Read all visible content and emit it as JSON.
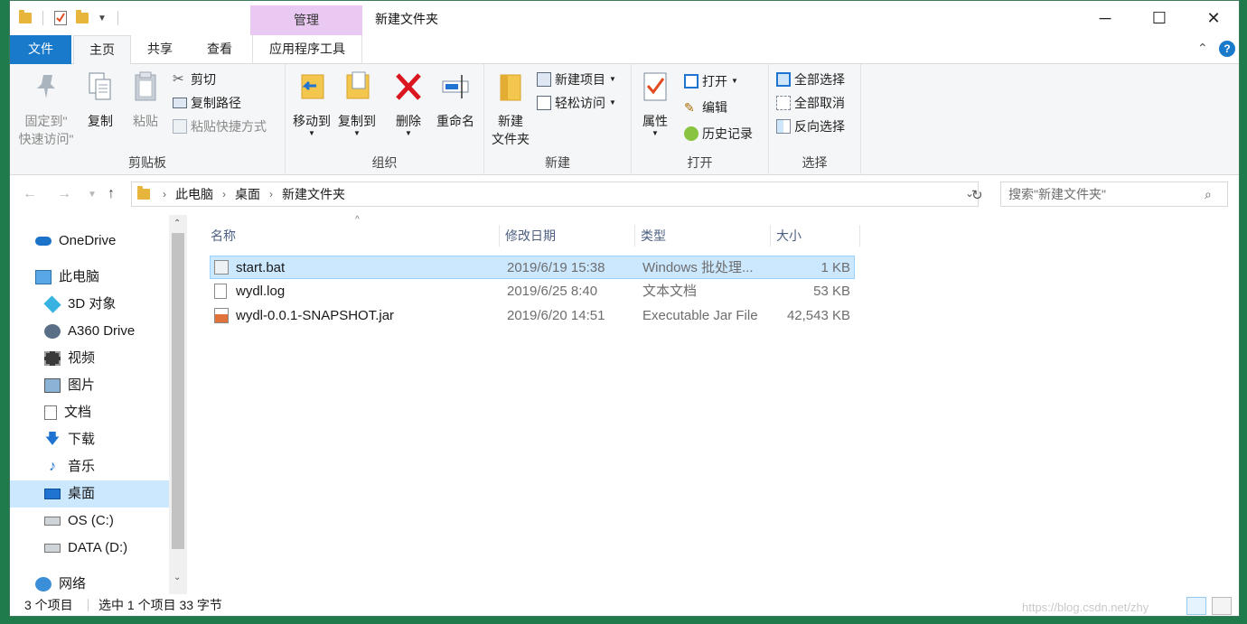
{
  "titlebar": {
    "manage_tab": "管理",
    "window_title": "新建文件夹",
    "minimize": "─",
    "maximize": "☐",
    "close": "✕"
  },
  "ribbon_tabs": [
    "文件",
    "主页",
    "共享",
    "查看",
    "应用程序工具"
  ],
  "ribbon": {
    "clipboard": {
      "label": "剪贴板",
      "pin": "固定到\"\n快速访问\"",
      "pin_line1": "固定到\"",
      "pin_line2": "快速访问\"",
      "copy": "复制",
      "paste": "粘贴",
      "cut": "剪切",
      "copy_path": "复制路径",
      "paste_shortcut": "粘贴快捷方式"
    },
    "organize": {
      "label": "组织",
      "move_to": "移动到",
      "copy_to": "复制到",
      "delete": "删除",
      "rename": "重命名"
    },
    "new": {
      "label": "新建",
      "new_folder_line1": "新建",
      "new_folder_line2": "文件夹",
      "new_item": "新建项目",
      "easy_access": "轻松访问"
    },
    "open": {
      "label": "打开",
      "properties": "属性",
      "open": "打开",
      "edit": "编辑",
      "history": "历史记录"
    },
    "select": {
      "label": "选择",
      "select_all": "全部选择",
      "select_none": "全部取消",
      "invert": "反向选择"
    }
  },
  "address": {
    "crumbs": [
      "此电脑",
      "桌面",
      "新建文件夹"
    ],
    "search_placeholder": "搜索\"新建文件夹\""
  },
  "nav": [
    {
      "label": "OneDrive",
      "icon": "onedrive-icon"
    },
    {
      "label": "此电脑",
      "icon": "pc-icon"
    },
    {
      "label": "3D 对象",
      "icon": "3d-objects-icon"
    },
    {
      "label": "A360 Drive",
      "icon": "a360-icon"
    },
    {
      "label": "视频",
      "icon": "video-icon"
    },
    {
      "label": "图片",
      "icon": "pictures-icon"
    },
    {
      "label": "文档",
      "icon": "documents-icon"
    },
    {
      "label": "下载",
      "icon": "download-icon"
    },
    {
      "label": "音乐",
      "icon": "music-icon"
    },
    {
      "label": "桌面",
      "icon": "desktop-icon"
    },
    {
      "label": "OS (C:)",
      "icon": "drive-icon"
    },
    {
      "label": "DATA (D:)",
      "icon": "drive-icon"
    },
    {
      "label": "网络",
      "icon": "network-icon"
    }
  ],
  "columns": [
    "名称",
    "修改日期",
    "类型",
    "大小"
  ],
  "files": [
    {
      "name": "start.bat",
      "date": "2019/6/19 15:38",
      "type": "Windows 批处理...",
      "size": "1 KB"
    },
    {
      "name": "wydl.log",
      "date": "2019/6/25 8:40",
      "type": "文本文档",
      "size": "53 KB"
    },
    {
      "name": "wydl-0.0.1-SNAPSHOT.jar",
      "date": "2019/6/20 14:51",
      "type": "Executable Jar File",
      "size": "42,543 KB"
    }
  ],
  "status": {
    "count": "3 个项目",
    "selected": "选中 1 个项目  33 字节"
  },
  "watermark": "https://blog.csdn.net/zhy",
  "colors": {
    "accent": "#1979ca",
    "selection": "#cce8ff",
    "manage_tab": "#e9c9f2"
  }
}
